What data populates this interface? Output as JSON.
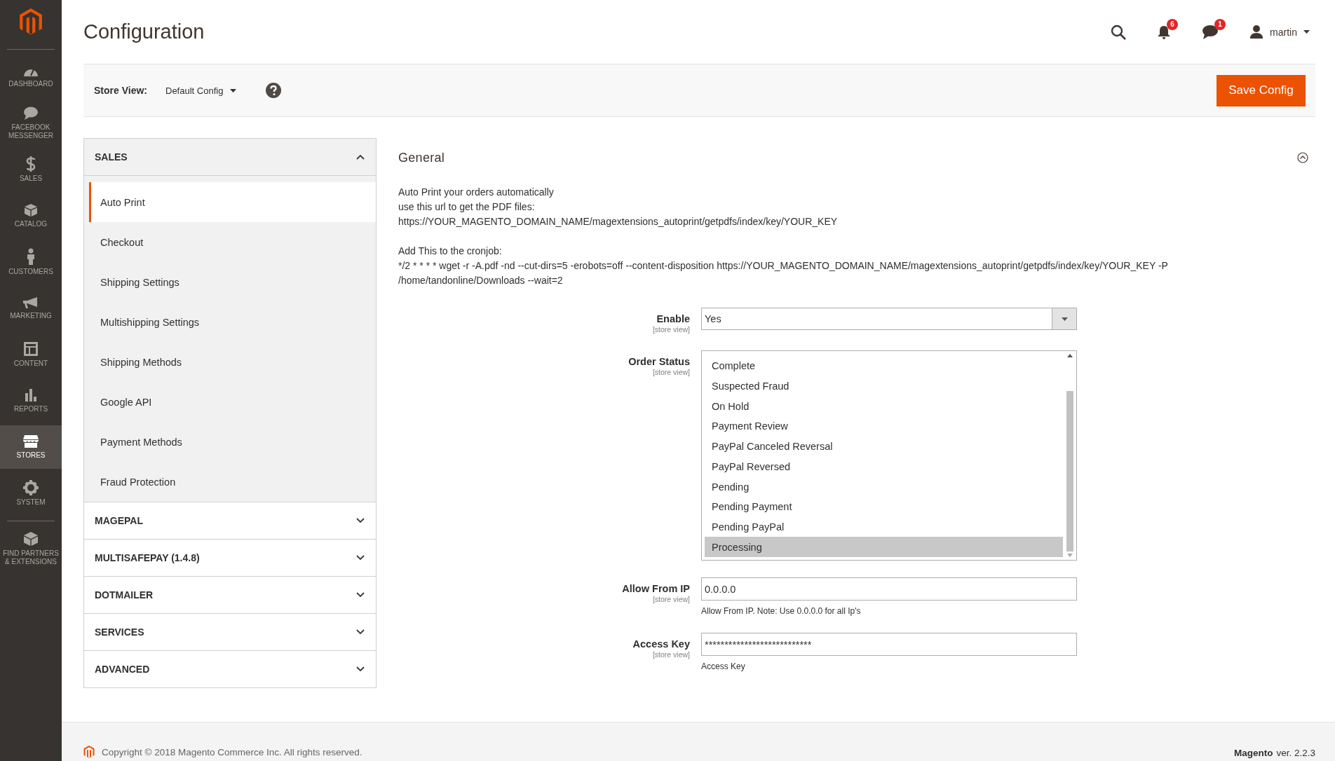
{
  "sidebar": {
    "items": [
      {
        "label": "DASHBOARD",
        "kind": "dashboard",
        "selected": false
      },
      {
        "label": "FACEBOOK MESSENGER",
        "kind": "chat",
        "selected": false
      },
      {
        "label": "SALES",
        "kind": "dollar",
        "selected": false
      },
      {
        "label": "CATALOG",
        "kind": "box",
        "selected": false
      },
      {
        "label": "CUSTOMERS",
        "kind": "person",
        "selected": false
      },
      {
        "label": "MARKETING",
        "kind": "megaphone",
        "selected": false
      },
      {
        "label": "CONTENT",
        "kind": "layout",
        "selected": false
      },
      {
        "label": "REPORTS",
        "kind": "bars",
        "selected": false
      },
      {
        "label": "STORES",
        "kind": "store",
        "selected": true
      },
      {
        "label": "SYSTEM",
        "kind": "gear",
        "selected": false
      },
      {
        "label": "FIND PARTNERS & EXTENSIONS",
        "kind": "blocks",
        "selected": false
      }
    ]
  },
  "header": {
    "title": "Configuration",
    "notifications": "6",
    "messages": "1",
    "user": "martin"
  },
  "scope_bar": {
    "label": "Store View:",
    "value": "Default Config",
    "save_button": "Save Config"
  },
  "tabs": [
    {
      "title": "SALES",
      "expanded": true,
      "items": [
        {
          "label": "Auto Print",
          "selected": true
        },
        {
          "label": "Checkout",
          "selected": false
        },
        {
          "label": "Shipping Settings",
          "selected": false
        },
        {
          "label": "Multishipping Settings",
          "selected": false
        },
        {
          "label": "Shipping Methods",
          "selected": false
        },
        {
          "label": "Google API",
          "selected": false
        },
        {
          "label": "Payment Methods",
          "selected": false
        },
        {
          "label": "Fraud Protection",
          "selected": false
        }
      ]
    },
    {
      "title": "MAGEPAL",
      "expanded": false
    },
    {
      "title": "MULTISAFEPAY (1.4.8)",
      "expanded": false
    },
    {
      "title": "DOTMAILER",
      "expanded": false
    },
    {
      "title": "SERVICES",
      "expanded": false
    },
    {
      "title": "ADVANCED",
      "expanded": false
    }
  ],
  "section": {
    "title": "General",
    "expanded": true,
    "description": [
      [
        "Auto Print your orders automatically",
        "use this url to get the PDF files:",
        "https://YOUR_MAGENTO_DOMAIN_NAME/magextensions_autoprint/getpdfs/index/key/YOUR_KEY"
      ],
      [
        "Add This to the cronjob:",
        "*/2 * * * * wget -r -A.pdf -nd --cut-dirs=5 -erobots=off --content-disposition https://YOUR_MAGENTO_DOMAIN_NAME/magextensions_autoprint/getpdfs/index/key/YOUR_KEY -P",
        "/home/tandonline/Downloads --wait=2"
      ]
    ],
    "fields": [
      {
        "kind": "select",
        "label": "Enable",
        "scope": "[store view]",
        "value": "Yes"
      },
      {
        "kind": "multiselect",
        "label": "Order Status",
        "scope": "[store view]",
        "options": [
          {
            "label": "Complete",
            "selected": false
          },
          {
            "label": "Suspected Fraud",
            "selected": false
          },
          {
            "label": "On Hold",
            "selected": false
          },
          {
            "label": "Payment Review",
            "selected": false
          },
          {
            "label": "PayPal Canceled Reversal",
            "selected": false
          },
          {
            "label": "PayPal Reversed",
            "selected": false
          },
          {
            "label": "Pending",
            "selected": false
          },
          {
            "label": "Pending Payment",
            "selected": false
          },
          {
            "label": "Pending PayPal",
            "selected": false
          },
          {
            "label": "Processing",
            "selected": true
          }
        ]
      },
      {
        "kind": "text",
        "label": "Allow From IP",
        "scope": "[store view]",
        "value": "0.0.0.0",
        "note": "Allow From IP. Note: Use 0.0.0.0 for all Ip's"
      },
      {
        "kind": "text",
        "label": "Access Key",
        "scope": "[store view]",
        "value": "***************************",
        "note": "Access Key"
      }
    ]
  },
  "footer": {
    "copyright": "Copyright © 2018 Magento Commerce Inc. All rights reserved.",
    "brand": "Magento",
    "version": "ver. 2.2.3"
  }
}
